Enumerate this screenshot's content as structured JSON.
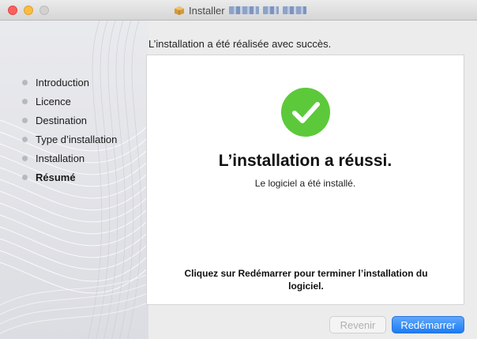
{
  "window": {
    "title": "Installer",
    "title_redacted": true
  },
  "sidebar": {
    "items": [
      {
        "label": "Introduction",
        "active": false
      },
      {
        "label": "Licence",
        "active": false
      },
      {
        "label": "Destination",
        "active": false
      },
      {
        "label": "Type d’installation",
        "active": false
      },
      {
        "label": "Installation",
        "active": false
      },
      {
        "label": "Résumé",
        "active": true
      }
    ]
  },
  "main": {
    "header": "L’installation a été réalisée avec succès.",
    "success_title": "L’installation a réussi.",
    "success_subtitle": "Le logiciel a été installé.",
    "restart_message": "Cliquez sur Redémarrer pour terminer l’installation du logiciel.",
    "status_icon": "checkmark-circle-icon"
  },
  "buttons": {
    "back_label": "Revenir",
    "back_enabled": false,
    "restart_label": "Redémarrer"
  },
  "colors": {
    "accent": "#1c7cf5",
    "success": "#5cc93b"
  }
}
